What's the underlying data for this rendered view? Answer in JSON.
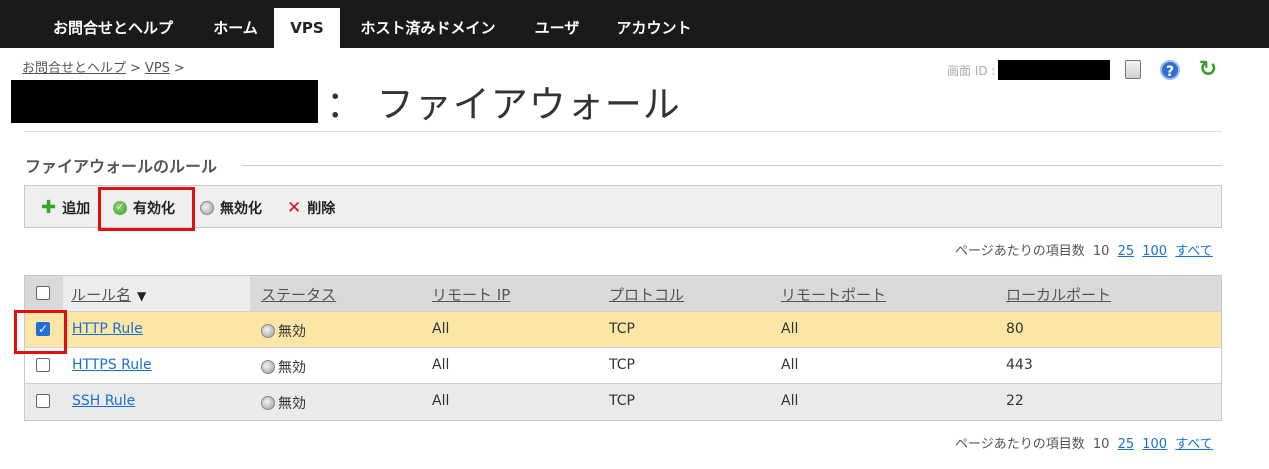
{
  "nav": {
    "tabs": [
      {
        "label": "お問合せとヘルプ",
        "active": false
      },
      {
        "label": "ホーム",
        "active": false
      },
      {
        "label": "VPS",
        "active": true
      },
      {
        "label": "ホスト済みドメイン",
        "active": false
      },
      {
        "label": "ユーザ",
        "active": false
      },
      {
        "label": "アカウント",
        "active": false
      }
    ]
  },
  "breadcrumb": {
    "items": [
      "お問合せとヘルプ",
      "VPS"
    ],
    "separator": ">"
  },
  "screen_id_label": "画面 ID :",
  "page_title": "： ファイアウォール",
  "section_title": "ファイアウォールのルール",
  "toolbar": {
    "add_label": "追加",
    "enable_label": "有効化",
    "disable_label": "無効化",
    "delete_label": "削除"
  },
  "pagination": {
    "label": "ページあたりの項目数",
    "current": "10",
    "options": [
      "25",
      "100",
      "すべて"
    ]
  },
  "table": {
    "columns": [
      "ルール名",
      "ステータス",
      "リモート IP",
      "プロトコル",
      "リモートポート",
      "ローカルポート"
    ],
    "rows": [
      {
        "name": "HTTP Rule",
        "status": "無効",
        "remote_ip": "All",
        "protocol": "TCP",
        "remote_port": "All",
        "local_port": "80",
        "checked": true
      },
      {
        "name": "HTTPS Rule",
        "status": "無効",
        "remote_ip": "All",
        "protocol": "TCP",
        "remote_port": "All",
        "local_port": "443",
        "checked": false
      },
      {
        "name": "SSH Rule",
        "status": "無効",
        "remote_ip": "All",
        "protocol": "TCP",
        "remote_port": "All",
        "local_port": "22",
        "checked": false
      }
    ]
  },
  "colors": {
    "nav_bg": "#1a1a1a",
    "link": "#1a6fd0",
    "selected_row": "#fbe6a6",
    "highlight_box": "#e01010",
    "enable_icon": "#3a9a2a"
  },
  "icons": {
    "manual": "document-icon",
    "help": "help-icon",
    "refresh": "refresh-icon"
  }
}
